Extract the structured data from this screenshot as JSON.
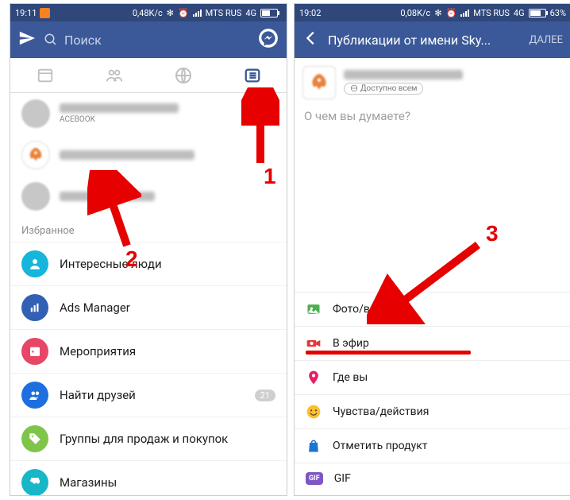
{
  "left": {
    "status": {
      "time": "19:11",
      "speed": "0,48K/c",
      "carrier": "MTS RUS",
      "net": "4G",
      "battery": ""
    },
    "search_placeholder": "Поиск",
    "profile_sub": "ACEBOOK",
    "favorites_label": "Избранное",
    "menu": {
      "interesting": "Интересные люди",
      "ads": "Ads Manager",
      "events": "Мероприятия",
      "friends": "Найти друзей",
      "friends_badge": "21",
      "groups": "Группы для продаж и покупок",
      "shops": "Магазины"
    }
  },
  "right": {
    "status": {
      "time": "19:02",
      "speed": "0,08K/c",
      "carrier": "MTS RUS",
      "net": "4G",
      "battery": "63%"
    },
    "title": "Публикации от имени Sky...",
    "next": "ДАЛЕЕ",
    "visibility": "Доступно всем",
    "placeholder": "О чем вы думаете?",
    "opts": {
      "photo": "Фото/видео",
      "live": "В эфир",
      "where": "Где вы",
      "feeling": "Чувства/действия",
      "product": "Отметить продукт",
      "gif": "GIF"
    }
  },
  "annot": {
    "n1": "1",
    "n2": "2",
    "n3": "3"
  }
}
